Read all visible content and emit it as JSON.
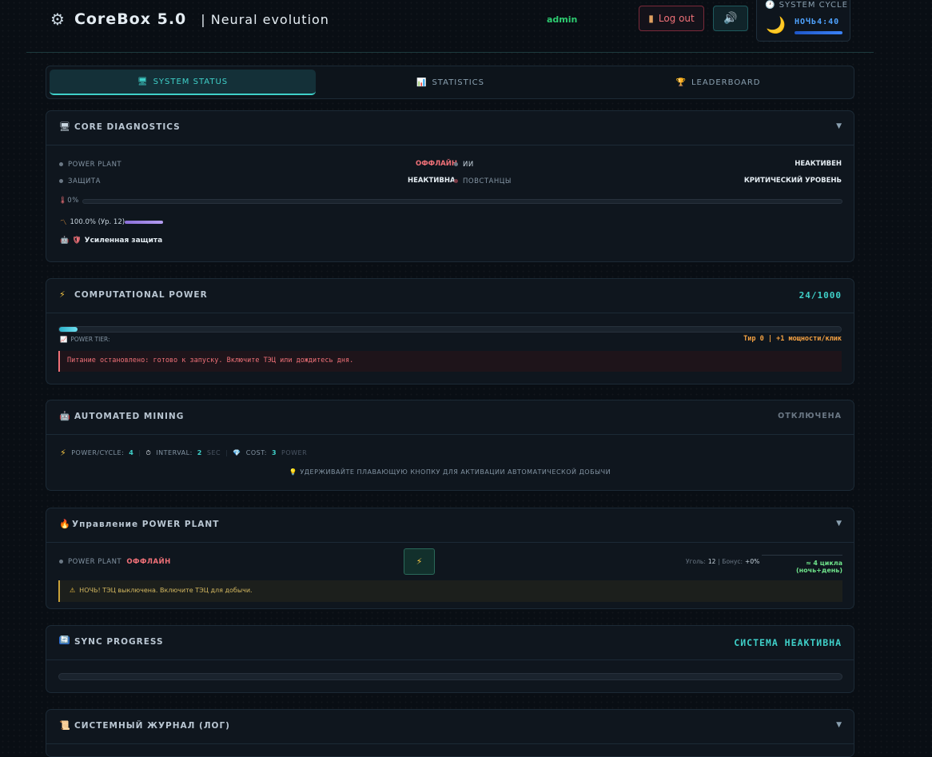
{
  "header": {
    "title": "CoreBox 5.0",
    "subtitle": "| Neural evolution",
    "user": "admin",
    "logout_label": "Log out",
    "cycle_label": "SYSTEM CYCLE",
    "cycle_phase": "НОЧЬ4:40",
    "icons": [
      "gear-icon",
      "door-icon",
      "speaker-icon",
      "clock-icon",
      "moon-icon"
    ]
  },
  "tabs": [
    {
      "label": "SYSTEM STATUS",
      "icon": "monitor-icon",
      "active": true
    },
    {
      "label": "STATISTICS",
      "icon": "chart-icon",
      "active": false
    },
    {
      "label": "LEADERBOARD",
      "icon": "trophy-icon",
      "active": false
    }
  ],
  "diagnostics": {
    "title": "CORE DIAGNOSTICS",
    "items": [
      {
        "label": "POWER PLANT",
        "value": "ОФФЛАЙН"
      },
      {
        "label": "ИИ",
        "value": "НЕАКТИВЕН"
      },
      {
        "label": "ЗАЩИТА",
        "value": "НЕАКТИВНА"
      },
      {
        "label": "ПОВСТАНЦЫ",
        "value": "КРИТИЧЕСКИЙ УРОВЕНЬ"
      }
    ],
    "temp_value": "0%",
    "efficiency": "100.0% (Ур. 12)",
    "efficiency_fraction": 1.0,
    "defense_label": "Усиленная защита"
  },
  "power": {
    "title": "COMPUTATIONAL POWER",
    "value": "24/1000",
    "fraction": 0.024,
    "tier_label": "POWER TIER:",
    "tier_value": "Тир 0 | +1 мощности/клик",
    "message": "Питание остановлено: готово к запуску. Включите ТЭЦ или дождитесь дня."
  },
  "mining": {
    "title": "AUTOMATED MINING",
    "status": "ОТКЛЮЧЕНА",
    "power_cycle_label": "POWER/CYCLE:",
    "power_cycle_value": "4",
    "interval_label": "INTERVAL:",
    "interval_value": "2",
    "interval_unit": "SEC",
    "cost_label": "COST:",
    "cost_value": "3",
    "cost_unit": "POWER",
    "hint": "УДЕРЖИВАЙТЕ ПЛАВАЮЩУЮ КНОПКУ ДЛЯ АКТИВАЦИИ АВТОМАТИЧЕСКОЙ ДОБЫЧИ"
  },
  "plant": {
    "title": "Управление POWER PLANT",
    "label": "POWER PLANT",
    "status": "ОФФЛАЙН",
    "coal_label": "Уголь:",
    "coal_value": "12",
    "bonus_label": "| Бонус:",
    "bonus_value": "+0%",
    "cycles": "≈ 4 цикла (ночь+день)",
    "warning": "НОЧЬ! ТЭЦ выключена. Включите ТЭЦ для добычи."
  },
  "sync": {
    "title": "SYNC PROGRESS",
    "status": "СИСТЕМА НЕАКТИВНА",
    "fraction": 0.0
  },
  "log": {
    "title": "СИСТЕМНЫЙ ЖУРНАЛ (ЛОГ)"
  },
  "colors": {
    "accent": "#3fd0c9",
    "danger": "#f07178",
    "success": "#2ecc71",
    "warning": "#f5c542"
  }
}
